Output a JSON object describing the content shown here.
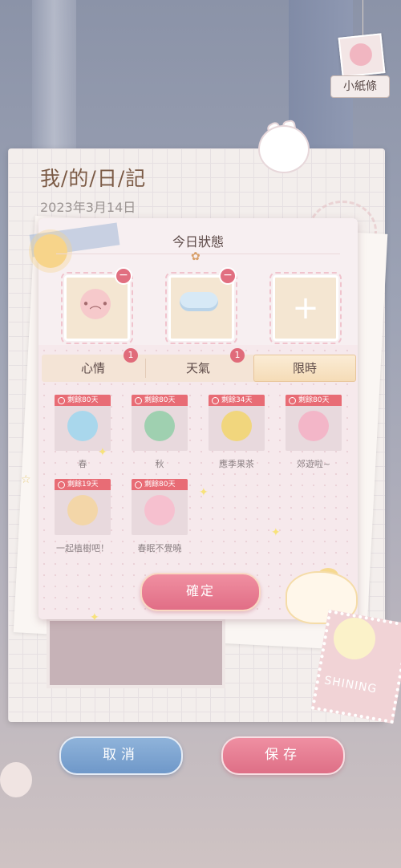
{
  "top_right": {
    "note_label": "小紙條"
  },
  "diary": {
    "title": "我/的/日/記",
    "date": "2023年3月14日"
  },
  "modal": {
    "title": "今日狀態",
    "slots": [
      {
        "name": "mood-slot",
        "icon": "sad-face-icon"
      },
      {
        "name": "weather-slot",
        "icon": "cloud-icon"
      },
      {
        "name": "add-slot",
        "icon": "plus-icon"
      }
    ],
    "tabs": [
      {
        "label": "心情",
        "badge": "1"
      },
      {
        "label": "天氣",
        "badge": "1"
      },
      {
        "label": "限時",
        "badge": ""
      }
    ],
    "items": [
      {
        "tag": "剩餘80天",
        "label": "春",
        "color": "#a9d7ec"
      },
      {
        "tag": "剩餘80天",
        "label": "秋",
        "color": "#9fd0b0"
      },
      {
        "tag": "剩餘34天",
        "label": "應季果茶",
        "color": "#f1d67d"
      },
      {
        "tag": "剩餘80天",
        "label": "郊遊啦~",
        "color": "#f3b6c8"
      },
      {
        "tag": "剩餘19天",
        "label": "一起植樹吧！",
        "color": "#f3d6a8"
      },
      {
        "tag": "剩餘80天",
        "label": "春眠不覺曉",
        "color": "#f6c0cf"
      }
    ],
    "confirm_label": "確定"
  },
  "footer": {
    "cancel_label": "取消",
    "save_label": "保存"
  },
  "decor": {
    "stamp_text": "SHINING"
  },
  "colors": {
    "accent_pink": "#e16e86",
    "accent_blue": "#6f98c9",
    "badge_red": "#e06b7a"
  }
}
